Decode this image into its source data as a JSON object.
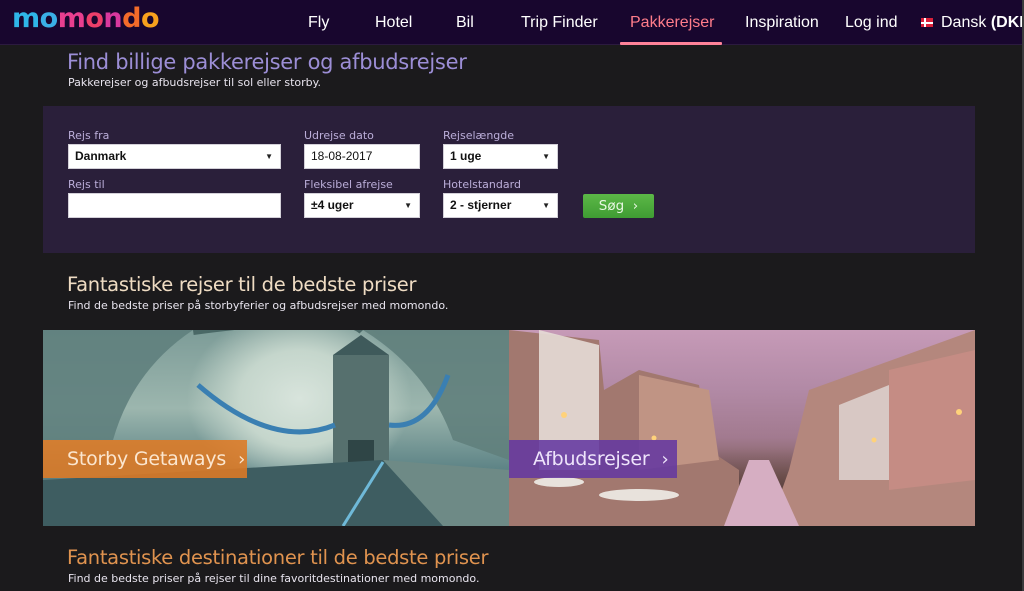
{
  "brand": {
    "name": "momondo",
    "letters": [
      {
        "char": "m",
        "color": "#2fb6e8"
      },
      {
        "char": "o",
        "color": "#3ab0e6"
      },
      {
        "char": "m",
        "color": "#e83f8f"
      },
      {
        "char": "o",
        "color": "#ec3f6a"
      },
      {
        "char": "n",
        "color": "#d9389e"
      },
      {
        "char": "d",
        "color": "#f36b2a"
      },
      {
        "char": "o",
        "color": "#f7a11d"
      }
    ]
  },
  "nav": {
    "items": [
      {
        "label": "Fly",
        "icon": "plane-icon"
      },
      {
        "label": "Hotel",
        "icon": "bed-icon"
      },
      {
        "label": "Bil",
        "icon": "car-icon"
      },
      {
        "label": "Trip Finder",
        "icon": "map-pin-icon"
      },
      {
        "label": "Pakkerejser",
        "icon": "suitcase-icon",
        "active": true
      },
      {
        "label": "Inspiration",
        "icon": "globe-icon"
      },
      {
        "label": "Log ind",
        "icon": "user-icon"
      }
    ],
    "language": {
      "label": "Dansk",
      "currency": "(DKK)",
      "icon": "denmark-flag-icon"
    }
  },
  "hero": {
    "title": "Find billige pakkerejser og afbudsrejser",
    "subtitle": "Pakkerejser og afbudsrejser til sol eller storby."
  },
  "search": {
    "from_label": "Rejs fra",
    "from_value": "Danmark",
    "to_label": "Rejs til",
    "to_value": "",
    "date_label": "Udrejse dato",
    "date_value": "18-08-2017",
    "flex_label": "Fleksibel afrejse",
    "flex_value": "±4 uger",
    "length_label": "Rejselængde",
    "length_value": "1 uge",
    "hotel_label": "Hotelstandard",
    "hotel_value": "2 - stjerner",
    "button_label": "Søg",
    "button_chevron": "›",
    "caret": "▼"
  },
  "section_trips": {
    "title": "Fantastiske rejser til de bedste priser",
    "subtitle": "Find de bedste priser på storbyferier og afbudsrejser med momondo.",
    "cards": [
      {
        "label": "Storby Getaways",
        "chevron": "›",
        "accent": "#de7a24"
      },
      {
        "label": "Afbudsrejser",
        "chevron": "›",
        "accent": "#6438a0"
      }
    ]
  },
  "section_destinations": {
    "title": "Fantastiske destinationer til de bedste priser",
    "subtitle": "Find de bedste priser på rejser til dine favoritdestinationer med momondo."
  }
}
